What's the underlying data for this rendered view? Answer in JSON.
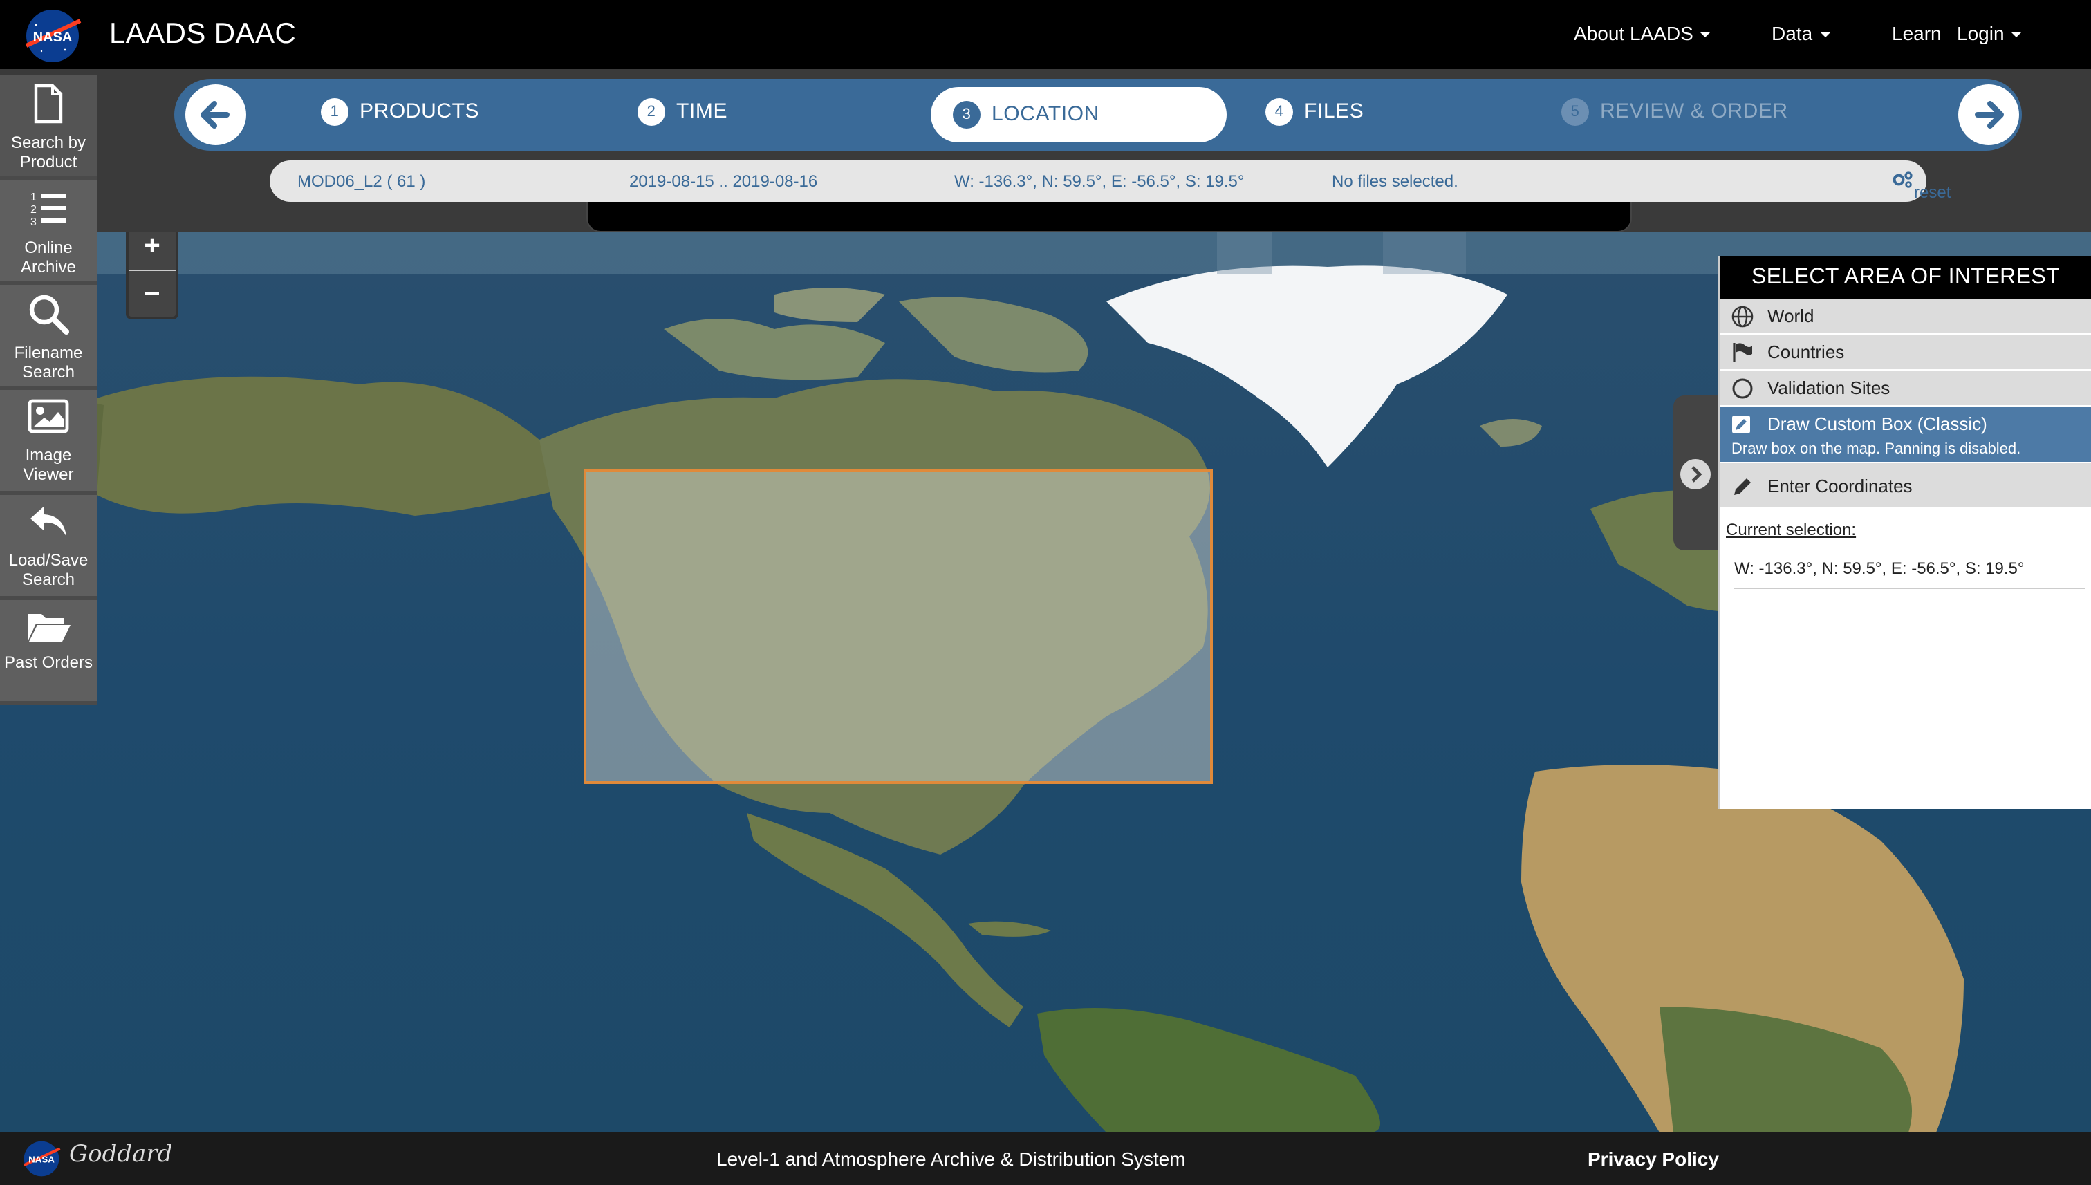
{
  "header": {
    "logo_text": "NASA",
    "title": "LAADS DAAC",
    "nav": [
      {
        "label": "About LAADS",
        "dropdown": true
      },
      {
        "label": "Data",
        "dropdown": true
      },
      {
        "label": "Learn",
        "dropdown": false
      },
      {
        "label": "Login",
        "dropdown": true
      }
    ]
  },
  "sidebar": {
    "items": [
      {
        "line1": "Search by",
        "line2": "Product",
        "icon": "document-icon",
        "active": true
      },
      {
        "line1": "Online",
        "line2": "Archive",
        "icon": "numbered-list-icon",
        "active": false
      },
      {
        "line1": "Filename",
        "line2": "Search",
        "icon": "search-icon",
        "active": false
      },
      {
        "line1": "Image",
        "line2": "Viewer",
        "icon": "image-icon",
        "active": false
      },
      {
        "line1": "Load/Save",
        "line2": "Search",
        "icon": "reply-arrow-icon",
        "active": false
      },
      {
        "line1": "Past Orders",
        "line2": "",
        "icon": "folder-open-icon",
        "active": false
      }
    ]
  },
  "steps": [
    {
      "num": "1",
      "label": "PRODUCTS",
      "state": "done"
    },
    {
      "num": "2",
      "label": "TIME",
      "state": "done"
    },
    {
      "num": "3",
      "label": "LOCATION",
      "state": "active"
    },
    {
      "num": "4",
      "label": "FILES",
      "state": "done"
    },
    {
      "num": "5",
      "label": "REVIEW & ORDER",
      "state": "disabled"
    }
  ],
  "summary": {
    "product": "MOD06_L2 ( 61 )",
    "dates": "2019-08-15 .. 2019-08-16",
    "location": "W: -136.3°, N: 59.5°, E: -56.5°, S: 19.5°",
    "files": "No files selected.",
    "reset": "reset"
  },
  "zoom": {
    "in": "+",
    "out": "−"
  },
  "panel": {
    "title": "SELECT AREA OF INTEREST",
    "options": [
      {
        "label": "World",
        "icon": "globe-icon"
      },
      {
        "label": "Countries",
        "icon": "flag-icon"
      },
      {
        "label": "Validation Sites",
        "icon": "circle-icon"
      },
      {
        "label": "Draw Custom Box (Classic)",
        "sub": "Draw box on the map. Panning is disabled.",
        "icon": "edit-box-icon",
        "active": true
      },
      {
        "label": "Enter Coordinates",
        "icon": "pencil-icon"
      }
    ],
    "current_label": "Current selection:",
    "current_value": "W: -136.3°, N: 59.5°, E: -56.5°, S: 19.5°"
  },
  "footer": {
    "org": "Goddard",
    "center_text": "Level-1 and Atmosphere Archive & Distribution System",
    "privacy": "Privacy Policy"
  },
  "colors": {
    "step_bar": "#3a6a98",
    "selection_border": "#e08a3a",
    "panel_active": "#4d7aa6"
  }
}
